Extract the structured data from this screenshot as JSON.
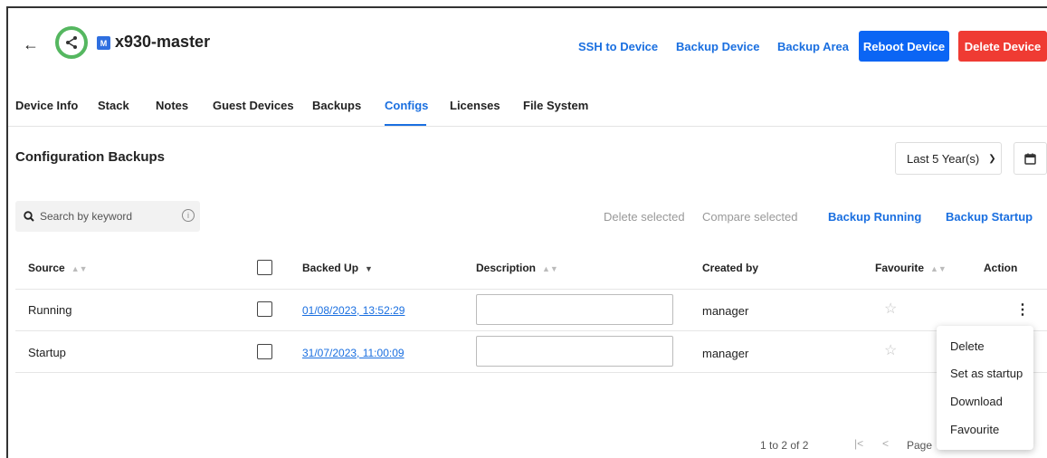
{
  "header": {
    "device_name": "x930-master",
    "badge_letter": "M",
    "links": [
      "SSH to Device",
      "Backup Device",
      "Backup Area"
    ],
    "reboot_label": "Reboot Device",
    "delete_label": "Delete Device"
  },
  "tabs": [
    {
      "label": "Device Info",
      "active": false
    },
    {
      "label": "Stack",
      "active": false
    },
    {
      "label": "Notes",
      "active": false
    },
    {
      "label": "Guest Devices",
      "active": false
    },
    {
      "label": "Backups",
      "active": false
    },
    {
      "label": "Configs",
      "active": true
    },
    {
      "label": "Licenses",
      "active": false
    },
    {
      "label": "File System",
      "active": false
    }
  ],
  "section": {
    "title": "Configuration Backups",
    "range_value": "Last 5 Year(s)"
  },
  "toolbar": {
    "search_placeholder": "Search by keyword",
    "delete_selected": "Delete selected",
    "compare_selected": "Compare selected",
    "backup_running": "Backup Running",
    "backup_startup": "Backup Startup"
  },
  "table": {
    "columns": {
      "source": "Source",
      "backed_up": "Backed Up",
      "description": "Description",
      "created_by": "Created by",
      "favourite": "Favourite",
      "action": "Action"
    },
    "rows": [
      {
        "source": "Running",
        "backed_up": "01/08/2023, 13:52:29",
        "description": "",
        "created_by": "manager",
        "favourite": false
      },
      {
        "source": "Startup",
        "backed_up": "31/07/2023, 11:00:09",
        "description": "",
        "created_by": "manager",
        "favourite": false
      }
    ]
  },
  "pagination": {
    "summary": "1 to 2 of 2",
    "page_label": "Page"
  },
  "menu": {
    "items": [
      "Delete",
      "Set as startup",
      "Download",
      "Favourite"
    ]
  },
  "colors": {
    "accent": "#1a6fe0",
    "reboot": "#0b65f4",
    "delete": "#ef3b33",
    "status_ring": "#55b760"
  },
  "icons": [
    "back-arrow-icon",
    "share-icon",
    "calendar-icon",
    "search-icon",
    "info-icon",
    "sort-icon",
    "star-icon",
    "kebab-icon",
    "first-page-icon",
    "prev-page-icon"
  ]
}
